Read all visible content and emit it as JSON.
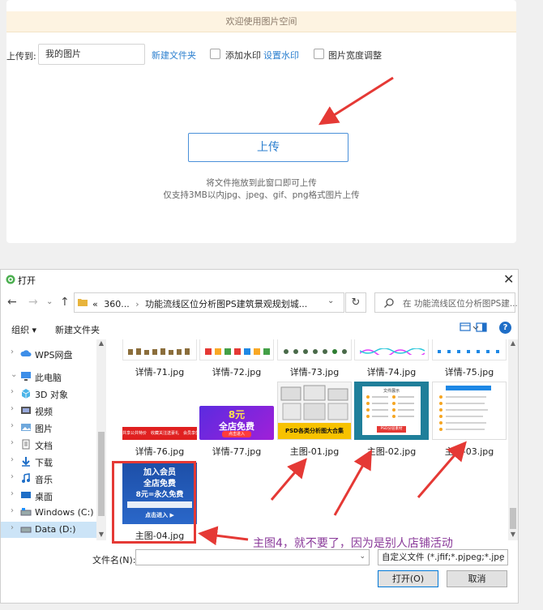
{
  "upload": {
    "welcome": "欢迎使用图片空间",
    "upload_to_label": "上传到:",
    "album_value": "我的图片",
    "new_folder": "新建文件夹",
    "watermark_label": "添加水印",
    "watermark_settings": "设置水印",
    "width_adjust_label": "图片宽度调整",
    "upload_button": "上传",
    "hint_drag": "将文件拖放到此窗口即可上传",
    "hint_formats": "仅支持3MB以内jpg、jpeg、gif、png格式图片上传"
  },
  "dialog": {
    "title": "打开",
    "close": "✕",
    "nav": {
      "back": "←",
      "forward": "→",
      "up": "↑"
    },
    "path_prefix": "«",
    "path_part1": "360...",
    "path_sep": "›",
    "path_part2": "功能流线区位分析图PS建筑景观规划城...",
    "refresh": "↻",
    "search_placeholder": "在 功能流线区位分析图PS建...",
    "organize": "组织 ▾",
    "new_folder": "新建文件夹",
    "help": "?",
    "sidebar": [
      {
        "label": "WPS网盘",
        "icon": "cloud-icon",
        "arrow": "›"
      },
      {
        "label": "此电脑",
        "icon": "computer-icon",
        "arrow": "⌄"
      },
      {
        "label": "3D 对象",
        "icon": "cube-icon",
        "arrow": "›"
      },
      {
        "label": "视频",
        "icon": "video-icon",
        "arrow": "›"
      },
      {
        "label": "图片",
        "icon": "picture-icon",
        "arrow": "›"
      },
      {
        "label": "文档",
        "icon": "document-icon",
        "arrow": "›"
      },
      {
        "label": "下载",
        "icon": "download-icon",
        "arrow": "›"
      },
      {
        "label": "音乐",
        "icon": "music-icon",
        "arrow": "›"
      },
      {
        "label": "桌面",
        "icon": "desktop-icon",
        "arrow": "›"
      },
      {
        "label": "Windows (C:)",
        "icon": "drive-icon",
        "arrow": "›"
      },
      {
        "label": "Data (D:)",
        "icon": "drive-icon",
        "arrow": "›"
      }
    ],
    "files": [
      {
        "name": "详情-71.jpg"
      },
      {
        "name": "详情-72.jpg"
      },
      {
        "name": "详情-73.jpg"
      },
      {
        "name": "详情-74.jpg"
      },
      {
        "name": "详情-75.jpg"
      },
      {
        "name": "详情-76.jpg",
        "thumb_text": "共享公共特价　收藏关注送豪礼　会员享优惠"
      },
      {
        "name": "详情-77.jpg",
        "thumb_big": "8元",
        "thumb_main": "全店免费",
        "thumb_small": "点击进入"
      },
      {
        "name": "主图-01.jpg",
        "thumb_text": "PSD各类分析图大合集"
      },
      {
        "name": "主图-02.jpg",
        "thumb_title": "文件展示",
        "thumb_footer": "PSD分层素材"
      },
      {
        "name": "主图-03.jpg"
      },
      {
        "name": "主图-04.jpg",
        "thumb_line1": "加入会员",
        "thumb_line2": "全店免费",
        "thumb_line3": "8元=永久免费",
        "thumb_line4": "点击进入 ▶"
      }
    ],
    "filename_label": "文件名(N):",
    "filename_value": "",
    "filetype_value": "自定义文件 (*.jfif;*.pjpeg;*.jpe",
    "open_button": "打开(O)",
    "cancel_button": "取消"
  },
  "annotation": "主图4，就不要了，因为是别人店铺活动",
  "colors": {
    "accent": "#2b7fcf",
    "annotation": "#8a3a9a",
    "arrow": "#e53935",
    "highlight": "#e53935"
  }
}
